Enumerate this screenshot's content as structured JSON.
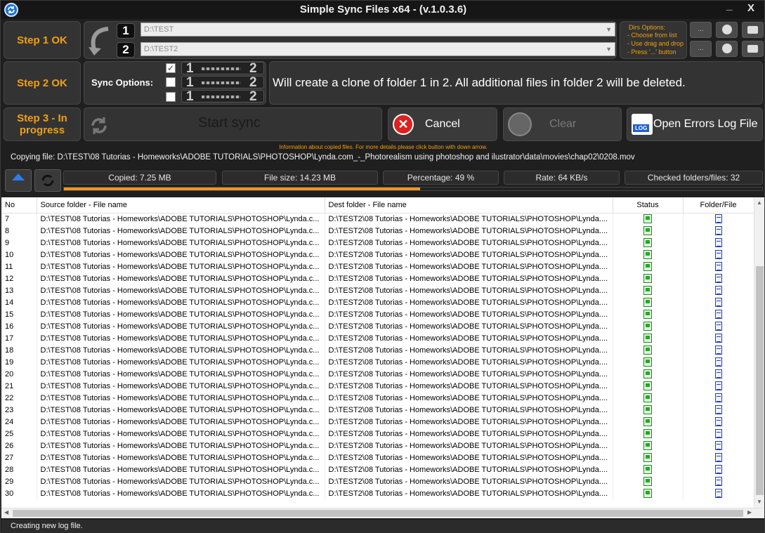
{
  "window": {
    "title": "Simple Sync Files  x64 - (v.1.0.3.6)",
    "minimize": "_",
    "close": "X"
  },
  "step1": {
    "label": "Step 1 OK",
    "num1": "1",
    "num2": "2",
    "dir1": "D:\\TEST",
    "dir2": "D:\\TEST2",
    "dirs_options": [
      "Dirs Options:",
      "- Choose from list",
      "- Use drag and drop",
      "- Press '...' button"
    ],
    "browse_label": "...",
    "clear_label": "..."
  },
  "step2": {
    "label": "Step 2 OK",
    "sync_options_label": "Sync Options:",
    "options": [
      {
        "checked": "✓",
        "left": "1",
        "right": "2"
      },
      {
        "checked": "",
        "left": "1",
        "right": "2"
      },
      {
        "checked": "",
        "left": "1",
        "right": "2"
      }
    ],
    "message": "Will create a clone of folder 1 in 2. All additional files in folder 2 will be deleted."
  },
  "step3": {
    "label_line1": "Step 3 - In",
    "label_line2": "progress",
    "start": "Start sync",
    "cancel": "Cancel",
    "clear": "Clear",
    "errors_log": "Open Errors Log File",
    "log_badge": "LOG"
  },
  "info": {
    "header": "Information about copied files. For more details please click button with down arrow.",
    "copying": "Copying file: D:\\TEST\\08 Tutorias - Homeworks\\ADOBE TUTORIALS\\PHOTOSHOP\\Lynda.com_-_Photorealism using photoshop and ilustrator\\data\\movies\\chap02\\0208.mov"
  },
  "stats": {
    "copied": "Copied: 7.25 MB",
    "file_size": "File size: 14.23 MB",
    "percentage": "Percentage: 49 %",
    "rate": "Rate: 64 KB/s",
    "checked": "Checked folders/files: 32",
    "progress_fraction": 0.51
  },
  "table": {
    "columns": [
      "No",
      "Source folder - File name",
      "Dest folder - File name",
      "Status",
      "Folder/File"
    ],
    "source": "D:\\TEST\\08 Tutorias - Homeworks\\ADOBE TUTORIALS\\PHOTOSHOP\\Lynda.c...",
    "dest": "D:\\TEST2\\08 Tutorias - Homeworks\\ADOBE TUTORIALS\\PHOTOSHOP\\Lynda....",
    "row_numbers": [
      "7",
      "8",
      "9",
      "10",
      "11",
      "12",
      "13",
      "14",
      "15",
      "16",
      "17",
      "18",
      "19",
      "20",
      "21",
      "22",
      "23",
      "24",
      "25",
      "26",
      "27",
      "28",
      "29",
      "30"
    ]
  },
  "statusbar": {
    "text": "Creating new log file."
  },
  "colors": {
    "accent": "#f0a010",
    "progress": "#f7941d",
    "background": "#1f1f1f"
  }
}
